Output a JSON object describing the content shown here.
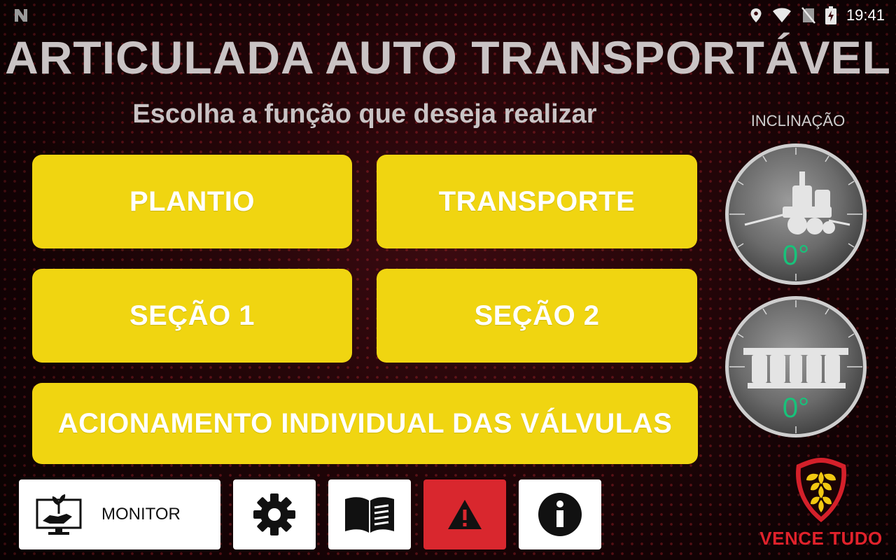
{
  "status_bar": {
    "time": "19:41"
  },
  "header": {
    "title": "ARTICULADA AUTO TRANSPORTÁVEL",
    "subtitle": "Escolha a função que deseja realizar"
  },
  "functions": {
    "plantio": "PLANTIO",
    "transporte": "TRANSPORTE",
    "secao1": "SEÇÃO 1",
    "secao2": "SEÇÃO 2",
    "valvulas": "ACIONAMENTO INDIVIDUAL DAS VÁLVULAS"
  },
  "inclination": {
    "label": "INCLINAÇÃO",
    "side_value": "0°",
    "rear_value": "0°"
  },
  "toolbar": {
    "monitor_label": "MONITOR"
  },
  "brand": {
    "name": "VENCE TUDO"
  },
  "colors": {
    "button_yellow": "#f0d511",
    "alert_red": "#d9272e",
    "gauge_value_green": "#18c27a",
    "brand_red": "#e0222b"
  },
  "icons": [
    "location-icon",
    "wifi-icon",
    "no-sim-icon",
    "battery-charging-icon",
    "monitor-plant-icon",
    "gear-icon",
    "book-icon",
    "warning-icon",
    "info-icon"
  ]
}
